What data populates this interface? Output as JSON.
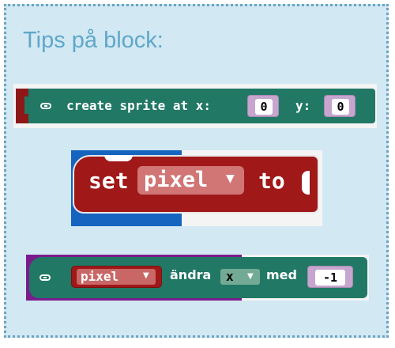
{
  "title": "Tips på block:",
  "block1": {
    "text": "create sprite at x:",
    "ylabel": "y:",
    "x_value": "0",
    "y_value": "0"
  },
  "block2": {
    "set": "set",
    "variable": "pixel",
    "to": "to"
  },
  "block3": {
    "variable": "pixel",
    "action": "ändra",
    "property": "x",
    "med": "med",
    "value": "-1"
  },
  "icons": {
    "dropdown": "dropdown-arrow-icon",
    "link": "link-icon"
  },
  "colors": {
    "panel": "#d2e8f3",
    "border": "#6aa4c1",
    "title": "#5fa7c9",
    "green": "#217865",
    "red": "#a01818",
    "purple": "#c6a6cf"
  }
}
